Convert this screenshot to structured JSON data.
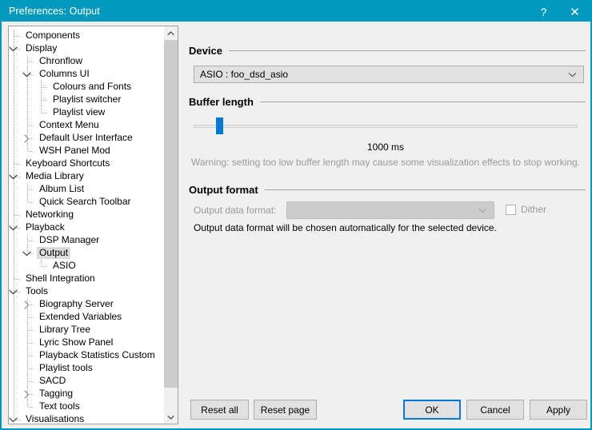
{
  "window": {
    "title": "Preferences: Output",
    "accent_color": "#0099bc",
    "caption": {
      "help_label": "?",
      "close_label": "✕"
    }
  },
  "tree": {
    "selected": "Output",
    "items": [
      {
        "label": "Components",
        "depth": 1,
        "expander": "none"
      },
      {
        "label": "Display",
        "depth": 1,
        "expander": "open"
      },
      {
        "label": "Chronflow",
        "depth": 2,
        "expander": "none"
      },
      {
        "label": "Columns UI",
        "depth": 2,
        "expander": "open"
      },
      {
        "label": "Colours and Fonts",
        "depth": 3,
        "expander": "none"
      },
      {
        "label": "Playlist switcher",
        "depth": 3,
        "expander": "none"
      },
      {
        "label": "Playlist view",
        "depth": 3,
        "expander": "none"
      },
      {
        "label": "Context Menu",
        "depth": 2,
        "expander": "none"
      },
      {
        "label": "Default User Interface",
        "depth": 2,
        "expander": "closed"
      },
      {
        "label": "WSH Panel Mod",
        "depth": 2,
        "expander": "none"
      },
      {
        "label": "Keyboard Shortcuts",
        "depth": 1,
        "expander": "none"
      },
      {
        "label": "Media Library",
        "depth": 1,
        "expander": "open"
      },
      {
        "label": "Album List",
        "depth": 2,
        "expander": "none"
      },
      {
        "label": "Quick Search Toolbar",
        "depth": 2,
        "expander": "none"
      },
      {
        "label": "Networking",
        "depth": 1,
        "expander": "none"
      },
      {
        "label": "Playback",
        "depth": 1,
        "expander": "open"
      },
      {
        "label": "DSP Manager",
        "depth": 2,
        "expander": "none"
      },
      {
        "label": "Output",
        "depth": 2,
        "expander": "open"
      },
      {
        "label": "ASIO",
        "depth": 3,
        "expander": "none"
      },
      {
        "label": "Shell Integration",
        "depth": 1,
        "expander": "none"
      },
      {
        "label": "Tools",
        "depth": 1,
        "expander": "open"
      },
      {
        "label": "Biography Server",
        "depth": 2,
        "expander": "closed"
      },
      {
        "label": "Extended Variables",
        "depth": 2,
        "expander": "none"
      },
      {
        "label": "Library Tree",
        "depth": 2,
        "expander": "none"
      },
      {
        "label": "Lyric Show Panel",
        "depth": 2,
        "expander": "none"
      },
      {
        "label": "Playback Statistics Custom",
        "depth": 2,
        "expander": "none"
      },
      {
        "label": "Playlist tools",
        "depth": 2,
        "expander": "none"
      },
      {
        "label": "SACD",
        "depth": 2,
        "expander": "none"
      },
      {
        "label": "Tagging",
        "depth": 2,
        "expander": "closed"
      },
      {
        "label": "Text tools",
        "depth": 2,
        "expander": "none"
      },
      {
        "label": "Visualisations",
        "depth": 1,
        "expander": "open"
      }
    ]
  },
  "device": {
    "group_title": "Device",
    "selected": "ASIO : foo_dsd_asio"
  },
  "buffer": {
    "group_title": "Buffer length",
    "value_label": "1000 ms",
    "value_ms": 1000,
    "slider_percent": 6,
    "warning": "Warning: setting too low buffer length may cause some visualization effects to stop working.",
    "thumb_color": "#0078d7"
  },
  "output_format": {
    "group_title": "Output format",
    "data_format_label": "Output data format:",
    "data_format_value": "",
    "dither_label": "Dither",
    "dither_checked": false,
    "note": "Output data format will be chosen automatically for the selected device."
  },
  "buttons": {
    "reset_all": "Reset all",
    "reset_page": "Reset page",
    "ok": "OK",
    "cancel": "Cancel",
    "apply": "Apply"
  }
}
